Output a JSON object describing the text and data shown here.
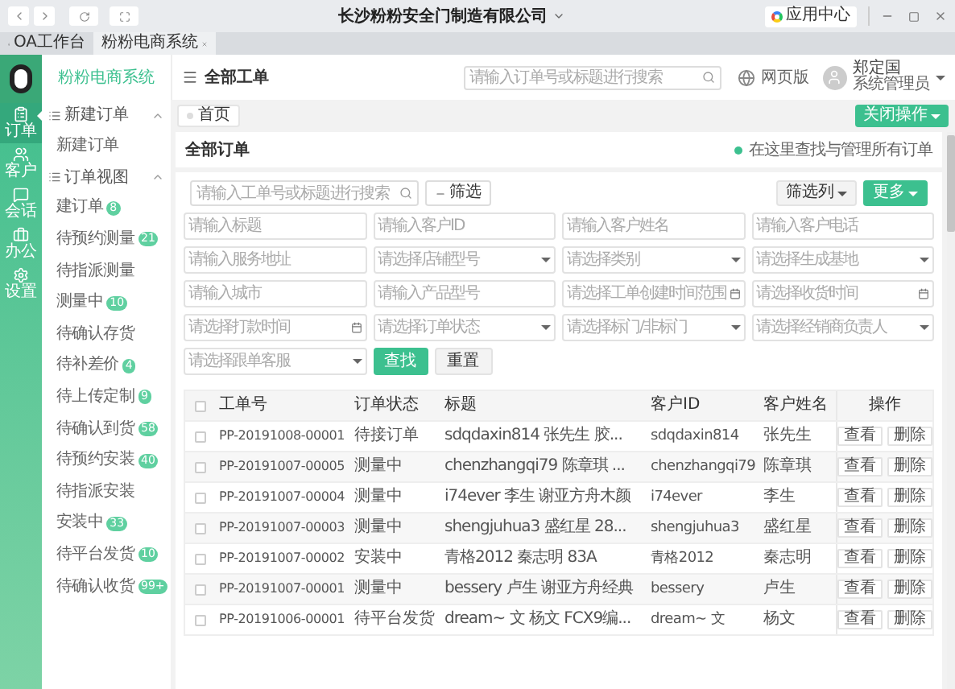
{
  "window": {
    "title": "长沙粉粉安全门制造有限公司",
    "app_center": "应用中心"
  },
  "browser_tabs": [
    {
      "label": "OA工作台",
      "selected": false,
      "closable": false
    },
    {
      "label": "粉粉电商系统",
      "selected": true,
      "closable": true
    }
  ],
  "header": {
    "system_name": "粉粉电商系统",
    "page_title": "全部工单",
    "search": {
      "placeholder": "请输入订单号或标题进行搜索"
    },
    "web_version": "网页版",
    "user_name": "郑定国",
    "user_role": "系统管理员"
  },
  "rail": [
    {
      "label": "订单",
      "selected": true
    },
    {
      "label": "客户",
      "selected": false
    },
    {
      "label": "会话",
      "selected": false
    },
    {
      "label": "办公",
      "selected": false
    },
    {
      "label": "设置",
      "selected": false
    }
  ],
  "menu": [
    {
      "label": "新建订单",
      "expanded": true,
      "children": [
        {
          "label": "新建订单"
        }
      ]
    },
    {
      "label": "订单视图",
      "expanded": true,
      "children": [
        {
          "label": "建订单",
          "badge": "8"
        },
        {
          "label": "待预约测量",
          "badge": "21"
        },
        {
          "label": "待指派测量"
        },
        {
          "label": "测量中",
          "badge": "10"
        },
        {
          "label": "待确认存货"
        },
        {
          "label": "待补差价",
          "badge": "4"
        },
        {
          "label": "待上传定制",
          "badge": "9"
        },
        {
          "label": "待确认到货",
          "badge": "58"
        },
        {
          "label": "待预约安装",
          "badge": "40"
        },
        {
          "label": "待指派安装"
        },
        {
          "label": "安装中",
          "badge": "33"
        },
        {
          "label": "待平台发货",
          "badge": "10"
        },
        {
          "label": "待确认收货",
          "badge": "99+"
        }
      ]
    }
  ],
  "breadcrumb": {
    "tab": "首页",
    "close_button": "关闭操作"
  },
  "card": {
    "title": "全部订单",
    "hint": "在这里查找与管理所有订单",
    "search": {
      "placeholder": "请输入工单号或标题进行搜索"
    },
    "filter_button": "筛选",
    "columns_button": "筛选列",
    "more_button": "更多",
    "filters": [
      {
        "kind": "input",
        "placeholder": "请输入标题"
      },
      {
        "kind": "input",
        "placeholder": "请输入客户ID"
      },
      {
        "kind": "input",
        "placeholder": "请输入客户姓名"
      },
      {
        "kind": "input",
        "placeholder": "请输入客户电话"
      },
      {
        "kind": "input",
        "placeholder": "请输入服务地址"
      },
      {
        "kind": "select",
        "placeholder": "请选择店铺型号"
      },
      {
        "kind": "select",
        "placeholder": "请选择类别"
      },
      {
        "kind": "select",
        "placeholder": "请选择生成基地"
      },
      {
        "kind": "input",
        "placeholder": "请输入城市"
      },
      {
        "kind": "input",
        "placeholder": "请输入产品型号"
      },
      {
        "kind": "date",
        "placeholder": "请选择工单创建时间范围"
      },
      {
        "kind": "date",
        "placeholder": "请选择收货时间"
      },
      {
        "kind": "date",
        "placeholder": "请选择打款时间"
      },
      {
        "kind": "select",
        "placeholder": "请选择订单状态"
      },
      {
        "kind": "select",
        "placeholder": "请选择标门/非标门"
      },
      {
        "kind": "select",
        "placeholder": "请选择经销商负责人"
      },
      {
        "kind": "select",
        "placeholder": "请选择跟单客服"
      }
    ],
    "find_button": "查找",
    "reset_button": "重置"
  },
  "table": {
    "all_checked": false,
    "columns": [
      "工单号",
      "订单状态",
      "标题",
      "客户ID",
      "客户姓名",
      "操作"
    ],
    "rows": [
      {
        "checked": false,
        "cells": [
          "PP-20191008-00001",
          "待接订单",
          "sdqdaxin814 张先生 胶...",
          "sdqdaxin814",
          "张先生"
        ],
        "actions": [
          "查看",
          "删除"
        ]
      },
      {
        "checked": false,
        "cells": [
          "PP-20191007-00005",
          "测量中",
          "chenzhangqi79 陈章琪 ...",
          "chenzhangqi79",
          "陈章琪"
        ],
        "actions": [
          "查看",
          "删除"
        ]
      },
      {
        "checked": false,
        "cells": [
          "PP-20191007-00004",
          "测量中",
          "i74ever 李生 谢亚方舟木颜",
          "i74ever",
          "李生"
        ],
        "actions": [
          "查看",
          "删除"
        ]
      },
      {
        "checked": false,
        "cells": [
          "PP-20191007-00003",
          "测量中",
          "shengjuhua3 盛红星 28...",
          "shengjuhua3",
          "盛红星"
        ],
        "actions": [
          "查看",
          "删除"
        ]
      },
      {
        "checked": false,
        "cells": [
          "PP-20191007-00002",
          "安装中",
          "青格2012 秦志明 83A",
          "青格2012",
          "秦志明"
        ],
        "actions": [
          "查看",
          "删除"
        ]
      },
      {
        "checked": false,
        "cells": [
          "PP-20191007-00001",
          "测量中",
          "bessery 卢生 谢亚方舟经典",
          "bessery",
          "卢生"
        ],
        "actions": [
          "查看",
          "删除"
        ]
      },
      {
        "checked": false,
        "cells": [
          "PP-20191006-00001",
          "待平台发货",
          "dream~ 文 杨文 FCX9编...",
          "dream~ 文",
          "杨文"
        ],
        "actions": [
          "查看",
          "删除"
        ]
      }
    ]
  }
}
